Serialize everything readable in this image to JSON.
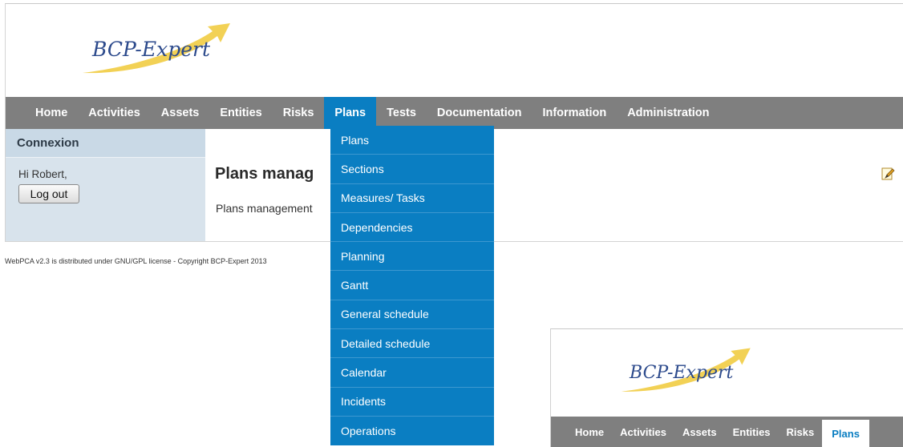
{
  "logo": {
    "text": "BCP-Expert"
  },
  "nav": {
    "items": [
      {
        "label": "Home"
      },
      {
        "label": "Activities"
      },
      {
        "label": "Assets"
      },
      {
        "label": "Entities"
      },
      {
        "label": "Risks"
      },
      {
        "label": "Plans",
        "active": true
      },
      {
        "label": "Tests"
      },
      {
        "label": "Documentation"
      },
      {
        "label": "Information"
      },
      {
        "label": "Administration"
      }
    ]
  },
  "sidebar": {
    "header": "Connexion",
    "greeting": "Hi Robert,",
    "logout_label": "Log out"
  },
  "main": {
    "title": "Plans manag",
    "description": "Plans management"
  },
  "footer": {
    "text": "WebPCA v2.3 is distributed under GNU/GPL license - Copyright BCP-Expert 2013"
  },
  "dropdown": {
    "items": [
      {
        "label": "Plans"
      },
      {
        "label": "Sections"
      },
      {
        "label": "Measures/ Tasks"
      },
      {
        "label": "Dependencies"
      },
      {
        "label": "Planning"
      },
      {
        "label": "Gantt"
      },
      {
        "label": "General schedule"
      },
      {
        "label": "Detailed schedule"
      },
      {
        "label": "Calendar"
      },
      {
        "label": "Incidents"
      },
      {
        "label": "Operations"
      }
    ]
  },
  "inset": {
    "logo_text": "BCP-Expert",
    "nav_items": [
      {
        "label": "Home"
      },
      {
        "label": "Activities"
      },
      {
        "label": "Assets"
      },
      {
        "label": "Entities"
      },
      {
        "label": "Risks"
      },
      {
        "label": "Plans",
        "active": true
      }
    ]
  },
  "colors": {
    "nav_bg": "#7f7f7f",
    "accent": "#0a7ec2",
    "sidebar_bg": "#d8e3ec",
    "logo_text": "#2c4a8c",
    "logo_swoosh": "#f2d155"
  },
  "icons": {
    "edit": "edit-icon",
    "logo_swoosh": "swoosh-arrow-icon"
  }
}
